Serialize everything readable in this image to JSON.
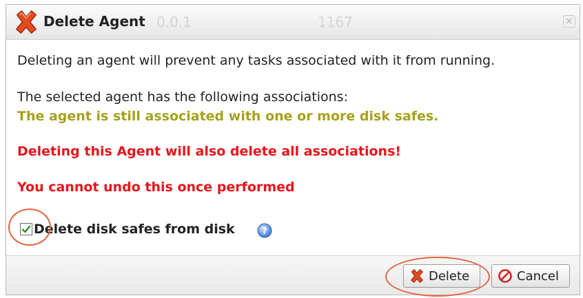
{
  "dialog": {
    "title": "Delete Agent",
    "background_ghost": {
      "ip_fragment": "0.0.1",
      "number": "1167"
    },
    "close_glyph": "✕"
  },
  "message": {
    "intro": "Deleting an agent will prevent any tasks associated with it from running.",
    "associations_header": "The selected agent has the following associations:",
    "association_item": "The agent is still associated with one or more disk safes.",
    "warning_delete": "Deleting this Agent will also delete all associations!",
    "warning_undo": "You cannot undo this once performed"
  },
  "option": {
    "label": "Delete disk safes from disk",
    "checked": true
  },
  "buttons": {
    "delete_label": "Delete",
    "cancel_label": "Cancel"
  },
  "icons": {
    "title": "red-x-icon",
    "help": "help-icon",
    "delete": "red-x-icon",
    "cancel": "no-entry-icon"
  },
  "colors": {
    "association_text": "#a6a11a",
    "warning_text": "#e8141b",
    "callout": "#e2653e"
  }
}
